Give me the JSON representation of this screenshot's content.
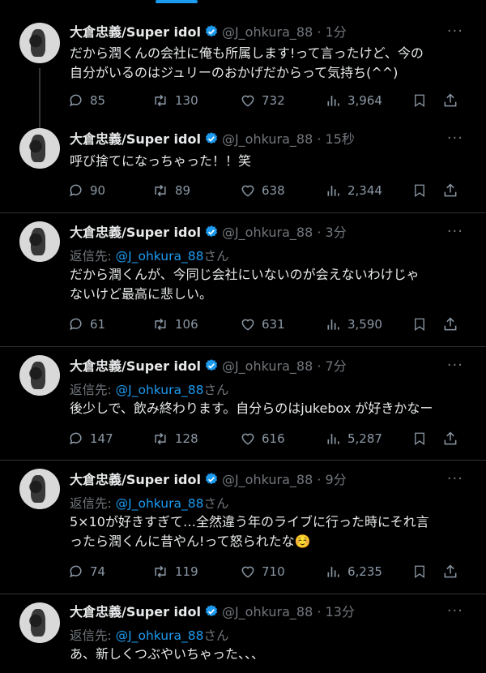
{
  "tweets": [
    {
      "name": "大倉忠義/Super idol",
      "handle": "@J_ohkura_88",
      "sep": "·",
      "time": "1分",
      "more": "···",
      "reply_prefix": "",
      "reply_mention": "",
      "reply_suffix": "",
      "lines": [
        "だから潤くんの会社に俺も所属します!って言ったけど、今の",
        "自分がいるのはジュリーのおかげだからって気持ち(^^)"
      ],
      "replies": "85",
      "retweets": "130",
      "likes": "732",
      "views": "3,964"
    },
    {
      "name": "大倉忠義/Super idol",
      "handle": "@J_ohkura_88",
      "sep": "·",
      "time": "15秒",
      "more": "···",
      "reply_prefix": "",
      "reply_mention": "",
      "reply_suffix": "",
      "lines": [
        "呼び捨てになっちゃった！！笑"
      ],
      "replies": "90",
      "retweets": "89",
      "likes": "638",
      "views": "2,344"
    },
    {
      "name": "大倉忠義/Super idol",
      "handle": "@J_ohkura_88",
      "sep": "·",
      "time": "3分",
      "more": "···",
      "reply_prefix": "返信先: ",
      "reply_mention": "@J_ohkura_88",
      "reply_suffix": "さん",
      "lines": [
        "だから潤くんが、今同じ会社にいないのが会えないわけじゃ",
        "ないけど最高に悲しい。"
      ],
      "replies": "61",
      "retweets": "106",
      "likes": "631",
      "views": "3,590"
    },
    {
      "name": "大倉忠義/Super idol",
      "handle": "@J_ohkura_88",
      "sep": "·",
      "time": "7分",
      "more": "···",
      "reply_prefix": "返信先: ",
      "reply_mention": "@J_ohkura_88",
      "reply_suffix": "さん",
      "lines": [
        "後少しで、飲み終わります。自分らのはjukebox が好きかなー"
      ],
      "replies": "147",
      "retweets": "128",
      "likes": "616",
      "views": "5,287"
    },
    {
      "name": "大倉忠義/Super idol",
      "handle": "@J_ohkura_88",
      "sep": "·",
      "time": "9分",
      "more": "···",
      "reply_prefix": "返信先: ",
      "reply_mention": "@J_ohkura_88",
      "reply_suffix": "さん",
      "lines": [
        "5×10が好きすぎて…全然違う年のライブに行った時にそれ言",
        "ったら潤くんに昔やん!って怒られたな☺️"
      ],
      "replies": "74",
      "retweets": "119",
      "likes": "710",
      "views": "6,235"
    },
    {
      "name": "大倉忠義/Super idol",
      "handle": "@J_ohkura_88",
      "sep": "·",
      "time": "13分",
      "more": "···",
      "reply_prefix": "返信先: ",
      "reply_mention": "@J_ohkura_88",
      "reply_suffix": "さん",
      "lines": [
        "あ、新しくつぶやいちゃった、、、"
      ],
      "replies": "",
      "retweets": "",
      "likes": "",
      "views": ""
    }
  ],
  "colors": {
    "accent": "#1d9bf0",
    "verified": "#1d9bf0",
    "muted": "#71767b",
    "text": "#e7e9ea",
    "background": "#000000"
  }
}
